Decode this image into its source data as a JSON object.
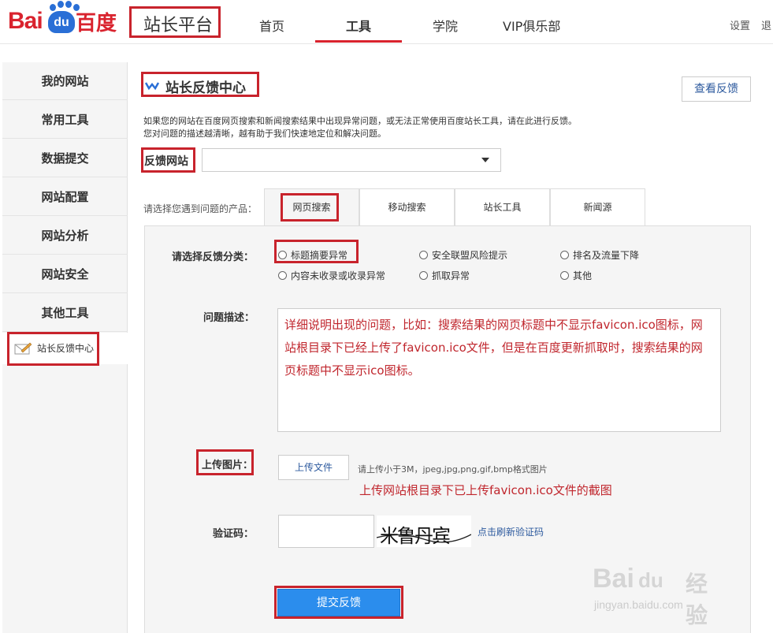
{
  "header": {
    "logo_bai": "Bai",
    "logo_du": "du",
    "logo_cn": "百度",
    "site_title": "站长平台",
    "nav": [
      "首页",
      "工具",
      "学院",
      "VIP俱乐部"
    ],
    "active_nav": "工具",
    "settings": "设置",
    "logout": "退"
  },
  "sidebar": {
    "items": [
      "我的网站",
      "常用工具",
      "数据提交",
      "网站配置",
      "网站分析",
      "网站安全",
      "其他工具"
    ],
    "active": "站长反馈中心"
  },
  "main": {
    "title": "站长反馈中心",
    "view_feedback": "查看反馈",
    "desc_line1": "如果您的网站在百度网页搜索和新闻搜索结果中出现异常问题，或无法正常使用百度站长工具，请在此进行反馈。",
    "desc_line2": "您对问题的描述越清晰，越有助于我们快速地定位和解决问题。",
    "site_label": "反馈网站",
    "site_value": "",
    "product_label": "请选择您遇到问题的产品：",
    "tabs": [
      "网页搜索",
      "移动搜索",
      "站长工具",
      "新闻源"
    ],
    "active_tab": "网页搜索"
  },
  "form": {
    "category_label": "请选择反馈分类：",
    "categories": [
      "标题摘要异常",
      "安全联盟风险提示",
      "排名及流量下降",
      "内容未收录或收录异常",
      "抓取异常",
      "其他"
    ],
    "description_label": "问题描述：",
    "description_text": "详细说明出现的问题，比如：搜索结果的网页标题中不显示favicon.ico图标，网站根目录下已经上传了favicon.ico文件，但是在百度更新抓取时，搜索结果的网页标题中不显示ico图标。",
    "upload_label": "上传图片：",
    "upload_button": "上传文件",
    "upload_hint": "请上传小于3M，jpeg,jpg,png,gif,bmp格式图片",
    "upload_note": "上传网站根目录下已上传favicon.ico文件的截图",
    "captcha_label": "验证码：",
    "captcha_text": "米鲁丹宾",
    "refresh_captcha": "点击刷新验证码",
    "submit": "提交反馈"
  },
  "watermark": {
    "brand": "Bai",
    "brand_du": "du",
    "brand_cn": "经验",
    "url": "jingyan.baidu.com"
  },
  "colors": {
    "brand_red": "#d9232e",
    "brand_blue": "#2a6fd6",
    "submit_blue": "#2b8ded",
    "annotation_red": "#c8232c"
  }
}
